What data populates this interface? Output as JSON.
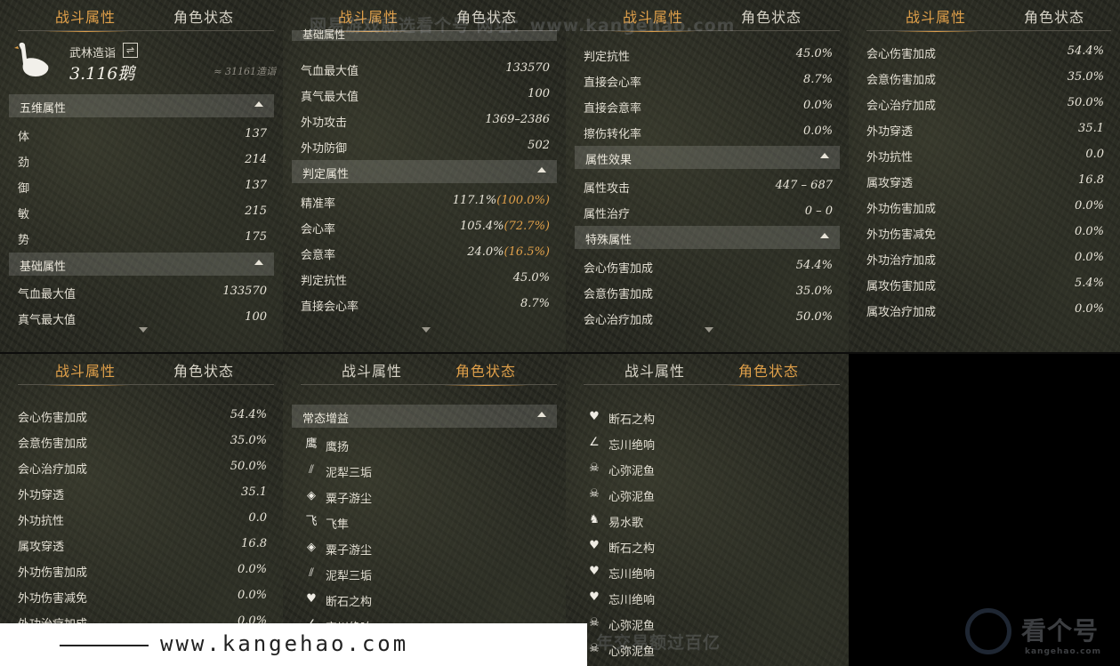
{
  "tabs": {
    "combat": "战斗属性",
    "status": "角色状态"
  },
  "header": {
    "title": "武林造诣",
    "value": "3.116鹅",
    "approx": "≈ 31161造诣"
  },
  "p1": {
    "sec_five": "五维属性",
    "five": [
      {
        "l": "体",
        "v": "137"
      },
      {
        "l": "劲",
        "v": "214"
      },
      {
        "l": "御",
        "v": "137"
      },
      {
        "l": "敏",
        "v": "215"
      },
      {
        "l": "势",
        "v": "175"
      }
    ],
    "sec_base": "基础属性",
    "base": [
      {
        "l": "气血最大值",
        "v": "133570"
      },
      {
        "l": "真气最大值",
        "v": "100"
      }
    ]
  },
  "p2": {
    "top_cut": "基础属性",
    "base": [
      {
        "l": "气血最大值",
        "v": "133570"
      },
      {
        "l": "真气最大值",
        "v": "100"
      },
      {
        "l": "外功攻击",
        "v": "1369–2386"
      },
      {
        "l": "外功防御",
        "v": "502"
      }
    ],
    "sec_judge": "判定属性",
    "judge": [
      {
        "l": "精准率",
        "v": "117.1%",
        "h": "(100.0%)"
      },
      {
        "l": "会心率",
        "v": "105.4%",
        "h": "(72.7%)"
      },
      {
        "l": "会意率",
        "v": "24.0%",
        "h": "(16.5%)"
      },
      {
        "l": "判定抗性",
        "v": "45.0%",
        "h": ""
      },
      {
        "l": "直接会心率",
        "v": "8.7%",
        "h": ""
      }
    ]
  },
  "p3": {
    "rows1": [
      {
        "l": "判定抗性",
        "v": "45.0%"
      },
      {
        "l": "直接会心率",
        "v": "8.7%"
      },
      {
        "l": "直接会意率",
        "v": "0.0%"
      },
      {
        "l": "擦伤转化率",
        "v": "0.0%"
      }
    ],
    "sec_effect": "属性效果",
    "effect": [
      {
        "l": "属性攻击",
        "v": "447 – 687"
      },
      {
        "l": "属性治疗",
        "v": "0 – 0"
      }
    ],
    "sec_special": "特殊属性",
    "special": [
      {
        "l": "会心伤害加成",
        "v": "54.4%"
      },
      {
        "l": "会意伤害加成",
        "v": "35.0%"
      },
      {
        "l": "会心治疗加成",
        "v": "50.0%"
      }
    ]
  },
  "p4": {
    "rows": [
      {
        "l": "会心伤害加成",
        "v": "54.4%"
      },
      {
        "l": "会意伤害加成",
        "v": "35.0%"
      },
      {
        "l": "会心治疗加成",
        "v": "50.0%"
      },
      {
        "l": "外功穿透",
        "v": "35.1"
      },
      {
        "l": "外功抗性",
        "v": "0.0"
      },
      {
        "l": "属攻穿透",
        "v": "16.8"
      },
      {
        "l": "外功伤害加成",
        "v": "0.0%"
      },
      {
        "l": "外功伤害减免",
        "v": "0.0%"
      },
      {
        "l": "外功治疗加成",
        "v": "0.0%"
      },
      {
        "l": "属攻伤害加成",
        "v": "5.4%"
      },
      {
        "l": "属攻治疗加成",
        "v": "0.0%"
      }
    ]
  },
  "p5": {
    "rows": [
      {
        "l": "会心伤害加成",
        "v": "54.4%"
      },
      {
        "l": "会意伤害加成",
        "v": "35.0%"
      },
      {
        "l": "会心治疗加成",
        "v": "50.0%"
      },
      {
        "l": "外功穿透",
        "v": "35.1"
      },
      {
        "l": "外功抗性",
        "v": "0.0"
      },
      {
        "l": "属攻穿透",
        "v": "16.8"
      },
      {
        "l": "外功伤害加成",
        "v": "0.0%"
      },
      {
        "l": "外功伤害减免",
        "v": "0.0%"
      },
      {
        "l": "外功治疗加成",
        "v": "0.0%"
      }
    ]
  },
  "p6": {
    "sec": "常态增益",
    "buffs": [
      {
        "icon": "hawk-icon",
        "g": "鹰",
        "l": "鹰扬"
      },
      {
        "icon": "claw-icon",
        "g": "⫽",
        "l": "泥犁三垢"
      },
      {
        "icon": "eye-icon",
        "g": "◈",
        "l": "粟子游尘"
      },
      {
        "icon": "wing-icon",
        "g": "飞",
        "l": "飞隼"
      },
      {
        "icon": "eye-icon",
        "g": "◈",
        "l": "粟子游尘"
      },
      {
        "icon": "claw-icon",
        "g": "⫽",
        "l": "泥犁三垢"
      },
      {
        "icon": "heart-icon",
        "g": "♥",
        "l": "断石之构"
      },
      {
        "icon": "feather-icon",
        "g": "∠",
        "l": "忘川绝响"
      }
    ]
  },
  "p7": {
    "buffs": [
      {
        "icon": "heart-icon",
        "g": "♥",
        "l": "断石之构"
      },
      {
        "icon": "feather-icon",
        "g": "∠",
        "l": "忘川绝响"
      },
      {
        "icon": "skull-icon",
        "g": "☠",
        "l": "心弥泥鱼"
      },
      {
        "icon": "skull-icon",
        "g": "☠",
        "l": "心弥泥鱼"
      },
      {
        "icon": "horse-icon",
        "g": "♞",
        "l": "易水歌"
      },
      {
        "icon": "heart-icon",
        "g": "♥",
        "l": "断石之构"
      },
      {
        "icon": "heart-icon",
        "g": "♥",
        "l": "忘川绝响"
      },
      {
        "icon": "heart-icon",
        "g": "♥",
        "l": "忘川绝响"
      },
      {
        "icon": "skull-icon",
        "g": "☠",
        "l": "心弥泥鱼"
      },
      {
        "icon": "skull-icon",
        "g": "☠",
        "l": "心弥泥鱼"
      }
    ]
  },
  "watermark": {
    "top": "网易游戏就选看个号  网址：www.kangehao.com",
    "bottom": "看个号专业网易游戏八年，年交易额过百亿",
    "logo": "看个号",
    "logo_sub": "kangehao.com"
  },
  "url_banner": "www.kangehao.com"
}
